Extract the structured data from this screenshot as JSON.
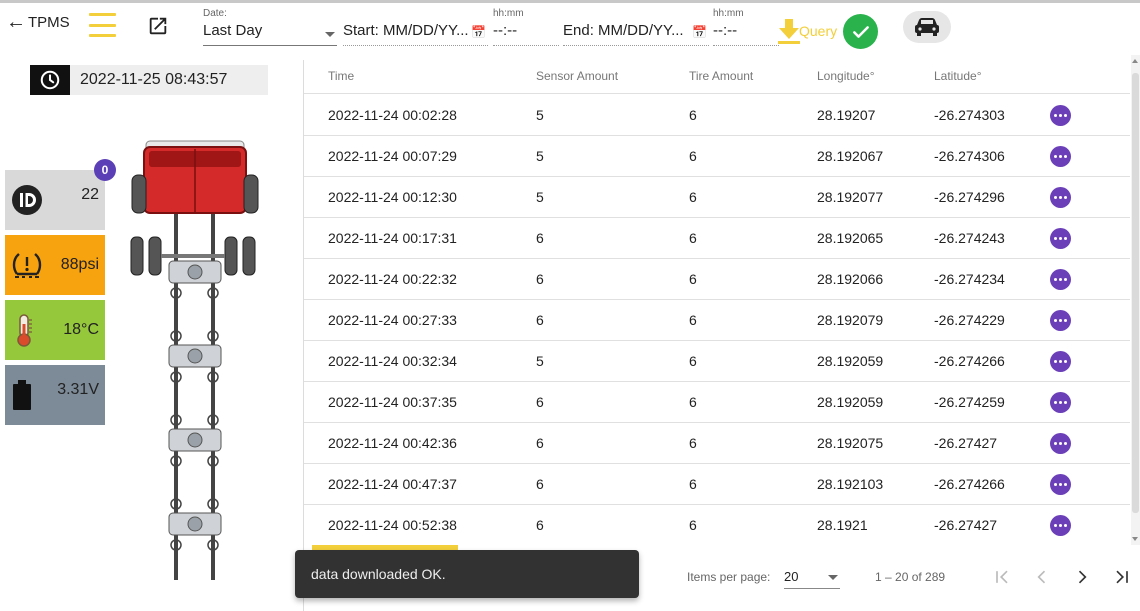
{
  "header": {
    "back_label": "TPMS",
    "date_label": "Date:",
    "date_value": "Last Day",
    "start_placeholder": "Start: MM/DD/YY...",
    "end_placeholder": "End: MM/DD/YY...",
    "time_label": "hh:mm",
    "time_placeholder": "--:--",
    "query_label": "Query",
    "accent_color": "#f2cf3b",
    "ok_color": "#2ab24d"
  },
  "sensor_panel": {
    "timestamp": "2022-11-25 08:43:57",
    "badge_count": "0",
    "cards": {
      "id": {
        "value": "22",
        "icon": "id-icon",
        "color": "#d9d9d9"
      },
      "pressure": {
        "value": "88psi",
        "icon": "tire-pressure-icon",
        "color": "#f7a20f"
      },
      "temperature": {
        "value": "18°C",
        "icon": "thermometer-icon",
        "color": "#96c83c"
      },
      "voltage": {
        "value": "3.31V",
        "icon": "battery-icon",
        "color": "#7d8b98"
      }
    }
  },
  "table": {
    "columns": [
      "Time",
      "Sensor Amount",
      "Tire Amount",
      "Longitude°",
      "Latitude°"
    ],
    "rows": [
      {
        "time": "2022-11-24 00:02:28",
        "sensor": "5",
        "tire": "6",
        "lon": "28.19207",
        "lat": "-26.274303"
      },
      {
        "time": "2022-11-24 00:07:29",
        "sensor": "5",
        "tire": "6",
        "lon": "28.192067",
        "lat": "-26.274306"
      },
      {
        "time": "2022-11-24 00:12:30",
        "sensor": "5",
        "tire": "6",
        "lon": "28.192077",
        "lat": "-26.274296"
      },
      {
        "time": "2022-11-24 00:17:31",
        "sensor": "6",
        "tire": "6",
        "lon": "28.192065",
        "lat": "-26.274243"
      },
      {
        "time": "2022-11-24 00:22:32",
        "sensor": "6",
        "tire": "6",
        "lon": "28.192066",
        "lat": "-26.274234"
      },
      {
        "time": "2022-11-24 00:27:33",
        "sensor": "6",
        "tire": "6",
        "lon": "28.192079",
        "lat": "-26.274229"
      },
      {
        "time": "2022-11-24 00:32:34",
        "sensor": "5",
        "tire": "6",
        "lon": "28.192059",
        "lat": "-26.274266"
      },
      {
        "time": "2022-11-24 00:37:35",
        "sensor": "6",
        "tire": "6",
        "lon": "28.192059",
        "lat": "-26.274259"
      },
      {
        "time": "2022-11-24 00:42:36",
        "sensor": "6",
        "tire": "6",
        "lon": "28.192075",
        "lat": "-26.27427"
      },
      {
        "time": "2022-11-24 00:47:37",
        "sensor": "6",
        "tire": "6",
        "lon": "28.192103",
        "lat": "-26.274266"
      },
      {
        "time": "2022-11-24 00:52:38",
        "sensor": "6",
        "tire": "6",
        "lon": "28.1921",
        "lat": "-26.27427"
      }
    ]
  },
  "paginator": {
    "items_per_page_label": "Items per page:",
    "items_per_page_value": "20",
    "range_label": "1 – 20 of 289"
  },
  "snackbar": {
    "message": "data downloaded OK."
  }
}
